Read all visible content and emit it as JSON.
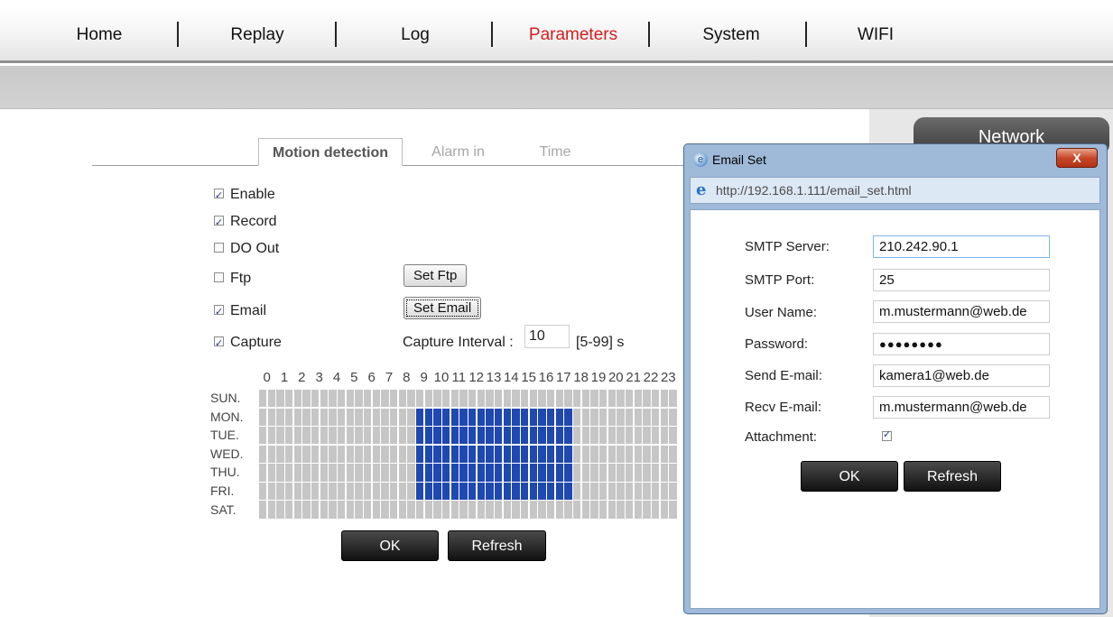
{
  "nav": {
    "items": [
      {
        "label": "Home",
        "active": false
      },
      {
        "label": "Replay",
        "active": false
      },
      {
        "label": "Log",
        "active": false
      },
      {
        "label": "Parameters",
        "active": true
      },
      {
        "label": "System",
        "active": false
      },
      {
        "label": "WIFI",
        "active": false
      }
    ]
  },
  "right_panel": {
    "network_button": "Network"
  },
  "tabs": [
    {
      "label": "Motion detection",
      "active": true
    },
    {
      "label": "Alarm in",
      "active": false
    },
    {
      "label": "Time",
      "active": false
    }
  ],
  "motion": {
    "options": [
      {
        "label": "Enable",
        "checked": true
      },
      {
        "label": "Record",
        "checked": true
      },
      {
        "label": "DO Out",
        "checked": false
      },
      {
        "label": "Ftp",
        "checked": false
      },
      {
        "label": "Email",
        "checked": true
      },
      {
        "label": "Capture",
        "checked": true
      }
    ],
    "set_ftp_label": "Set Ftp",
    "set_email_label": "Set Email",
    "capture_interval_label": "Capture Interval :",
    "capture_interval_value": "10",
    "capture_interval_range": "[5-99] s"
  },
  "schedule": {
    "hours": [
      "0",
      "1",
      "2",
      "3",
      "4",
      "5",
      "6",
      "7",
      "8",
      "9",
      "10",
      "11",
      "12",
      "13",
      "14",
      "15",
      "16",
      "17",
      "18",
      "19",
      "20",
      "21",
      "22",
      "23"
    ],
    "days": [
      "SUN.",
      "MON.",
      "TUE.",
      "WED.",
      "THU.",
      "FRI.",
      "SAT."
    ],
    "active_days": [
      1,
      2,
      3,
      4,
      5
    ],
    "active_hours": [
      9,
      17
    ],
    "colors": {
      "active": "#1f49b0",
      "inactive": "#c6c6c6",
      "grid": "#ffffff"
    }
  },
  "buttons": {
    "ok": "OK",
    "refresh": "Refresh"
  },
  "dialog": {
    "title": "Email Set",
    "close_label": "X",
    "url": "http://192.168.1.111/email_set.html",
    "fields": [
      {
        "label": "SMTP Server:",
        "value": "210.242.90.1"
      },
      {
        "label": "SMTP Port:",
        "value": "25"
      },
      {
        "label": "User Name:",
        "value": "m.mustermann@web.de"
      },
      {
        "label": "Password:",
        "value": "●●●●●●●●"
      },
      {
        "label": "Send E-mail:",
        "value": "kamera1@web.de"
      },
      {
        "label": "Recv E-mail:",
        "value": "m.mustermann@web.de"
      }
    ],
    "attachment_label": "Attachment:",
    "attachment_checked": true,
    "ok": "OK",
    "refresh": "Refresh"
  }
}
